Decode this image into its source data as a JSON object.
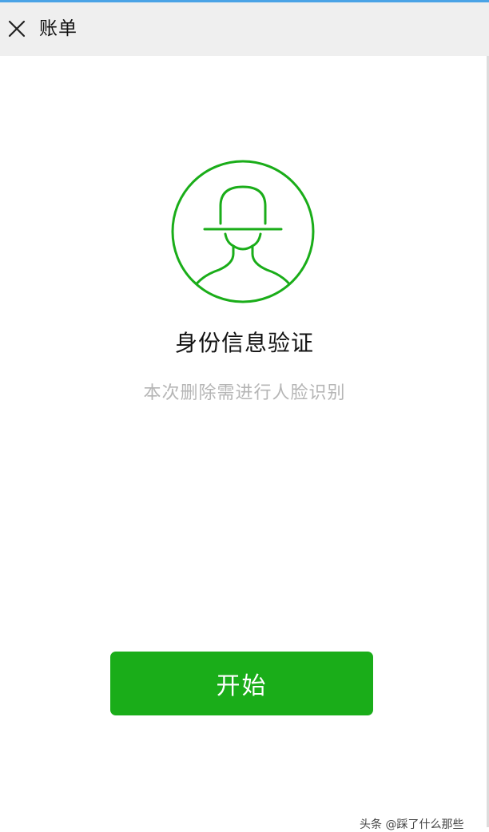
{
  "nav": {
    "close_icon": "close-icon",
    "title": "账单"
  },
  "verification": {
    "avatar_icon": "face-avatar-icon",
    "heading": "身份信息验证",
    "description": "本次删除需进行人脸识别"
  },
  "actions": {
    "start_label": "开始"
  },
  "footer": {
    "watermark": "头条 @踩了什么那些"
  },
  "colors": {
    "accent": "#1aad19",
    "nav_background": "#efefef",
    "top_accent": "#4aa3e6",
    "muted_text": "#b5b5b5"
  }
}
